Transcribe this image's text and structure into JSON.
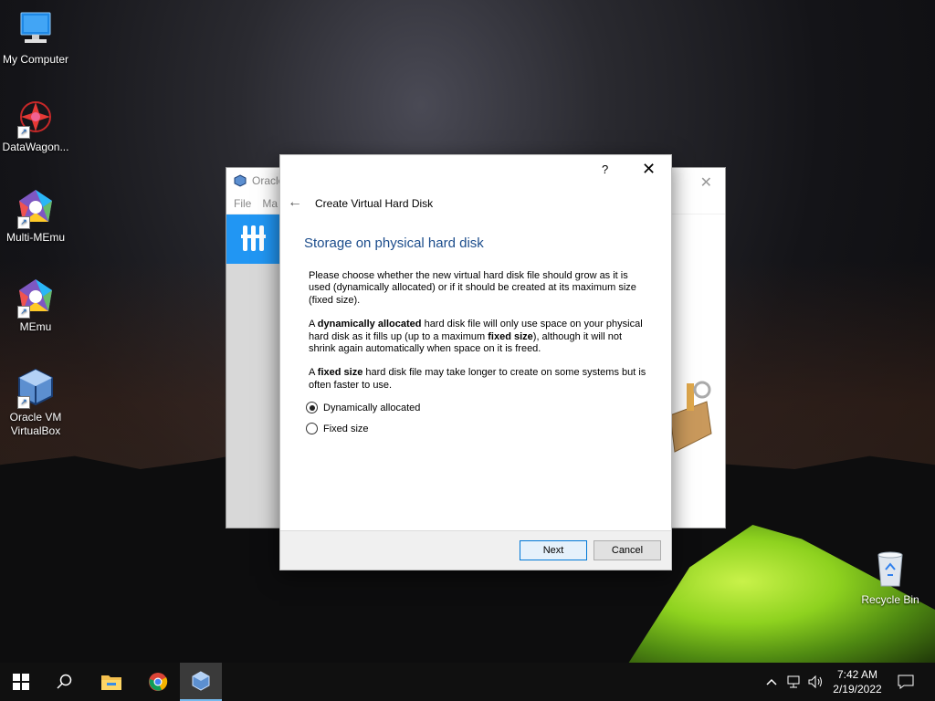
{
  "desktop": {
    "icons": [
      {
        "label": "My Computer"
      },
      {
        "label": "DataWagon..."
      },
      {
        "label": "Multi-MEmu"
      },
      {
        "label": "MEmu"
      },
      {
        "label": "Oracle VM VirtualBox"
      },
      {
        "label": "Recycle Bin"
      }
    ]
  },
  "vbox_window": {
    "title": "Oracle",
    "menu": [
      "File",
      "Ma"
    ]
  },
  "dialog": {
    "help_symbol": "?",
    "close_symbol": "✕",
    "back_symbol": "←",
    "wizard_title": "Create Virtual Hard Disk",
    "heading": "Storage on physical hard disk",
    "para1": "Please choose whether the new virtual hard disk file should grow as it is used (dynamically allocated) or if it should be created at its maximum size (fixed size).",
    "para2": {
      "pre": "A ",
      "b1": "dynamically allocated",
      "mid1": " hard disk file will only use space on your physical hard disk as it fills up (up to a maximum ",
      "b2": "fixed size",
      "post": "), although it will not shrink again automatically when space on it is freed."
    },
    "para3": {
      "pre": "A ",
      "b1": "fixed size",
      "post": " hard disk file may take longer to create on some systems but is often faster to use."
    },
    "options": [
      {
        "label": "Dynamically allocated",
        "selected": true
      },
      {
        "label": "Fixed size",
        "selected": false
      }
    ],
    "next_label": "Next",
    "cancel_label": "Cancel"
  },
  "taskbar": {
    "time": "7:42 AM",
    "date": "2/19/2022",
    "accent": "#76b9ed"
  }
}
